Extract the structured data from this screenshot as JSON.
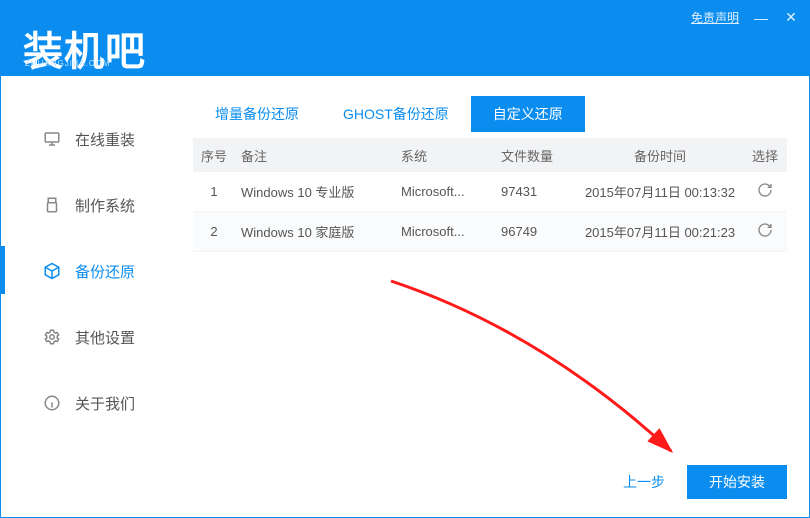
{
  "titlebar": {
    "logo_main": "装机吧",
    "logo_sub": "ZHUANGJIBA.COM",
    "disclaimer": "免责声明",
    "minimize": "—",
    "close": "✕"
  },
  "sidebar": {
    "items": [
      {
        "label": "在线重装",
        "icon": "monitor-icon"
      },
      {
        "label": "制作系统",
        "icon": "usb-icon"
      },
      {
        "label": "备份还原",
        "icon": "cube-icon"
      },
      {
        "label": "其他设置",
        "icon": "gear-icon"
      },
      {
        "label": "关于我们",
        "icon": "info-icon"
      }
    ],
    "active_index": 2
  },
  "tabs": {
    "items": [
      "增量备份还原",
      "GHOST备份还原",
      "自定义还原"
    ],
    "active_index": 2
  },
  "table": {
    "headers": {
      "idx": "序号",
      "remark": "备注",
      "sys": "系统",
      "files": "文件数量",
      "time": "备份时间",
      "sel": "选择"
    },
    "rows": [
      {
        "idx": "1",
        "remark": "Windows 10 专业版",
        "sys": "Microsoft...",
        "files": "97431",
        "time": "2015年07月11日 00:13:32"
      },
      {
        "idx": "2",
        "remark": "Windows 10 家庭版",
        "sys": "Microsoft...",
        "files": "96749",
        "time": "2015年07月11日 00:21:23"
      }
    ]
  },
  "footer": {
    "prev": "上一步",
    "install": "开始安装"
  }
}
